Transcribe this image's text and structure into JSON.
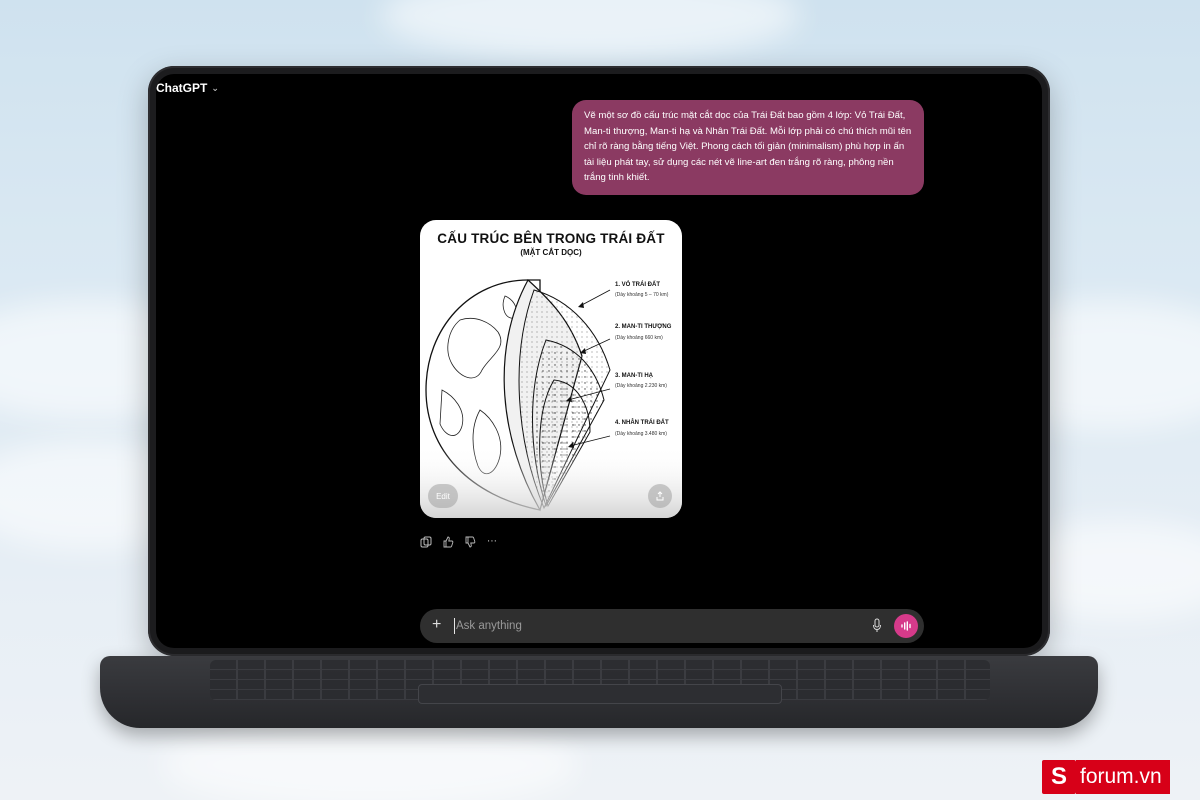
{
  "app": {
    "model_picker_label": "ChatGPT"
  },
  "conversation": {
    "user_message": "Vẽ một sơ đồ cấu trúc mặt cắt dọc của Trái Đất bao gồm 4 lớp: Vỏ Trái Đất, Man-ti thượng, Man-ti hạ và Nhân Trái Đất. Mỗi lớp phải có chú thích mũi tên chỉ rõ ràng bằng tiếng Việt. Phong cách tối giản (minimalism) phù hợp in ấn tài liệu phát tay, sử dụng các nét vẽ line-art đen trắng rõ ràng, phông nền trắng tinh khiết."
  },
  "generated_image": {
    "title": "CẤU TRÚC BÊN TRONG TRÁI ĐẤT",
    "subtitle": "(MẶT CẮT DỌC)",
    "layers": [
      {
        "label": "1. VỎ TRÁI ĐẤT",
        "note": "(Dày khoảng 5 – 70 km)"
      },
      {
        "label": "2. MAN-TI THƯỢNG",
        "note": "(Dày khoảng 660 km)"
      },
      {
        "label": "3. MAN-TI HẠ",
        "note": "(Dày khoảng 2.230 km)"
      },
      {
        "label": "4. NHÂN TRÁI ĐẤT",
        "note": "(Dày khoảng 3.480 km)"
      }
    ],
    "edit_label": "Edit"
  },
  "composer": {
    "placeholder": "Ask anything"
  },
  "watermark": {
    "text": "forum.vn",
    "logo_letter": "S"
  },
  "colors": {
    "user_bubble": "#8b3a62",
    "voice_button": "#d63a8a",
    "brand_red": "#d70018"
  }
}
